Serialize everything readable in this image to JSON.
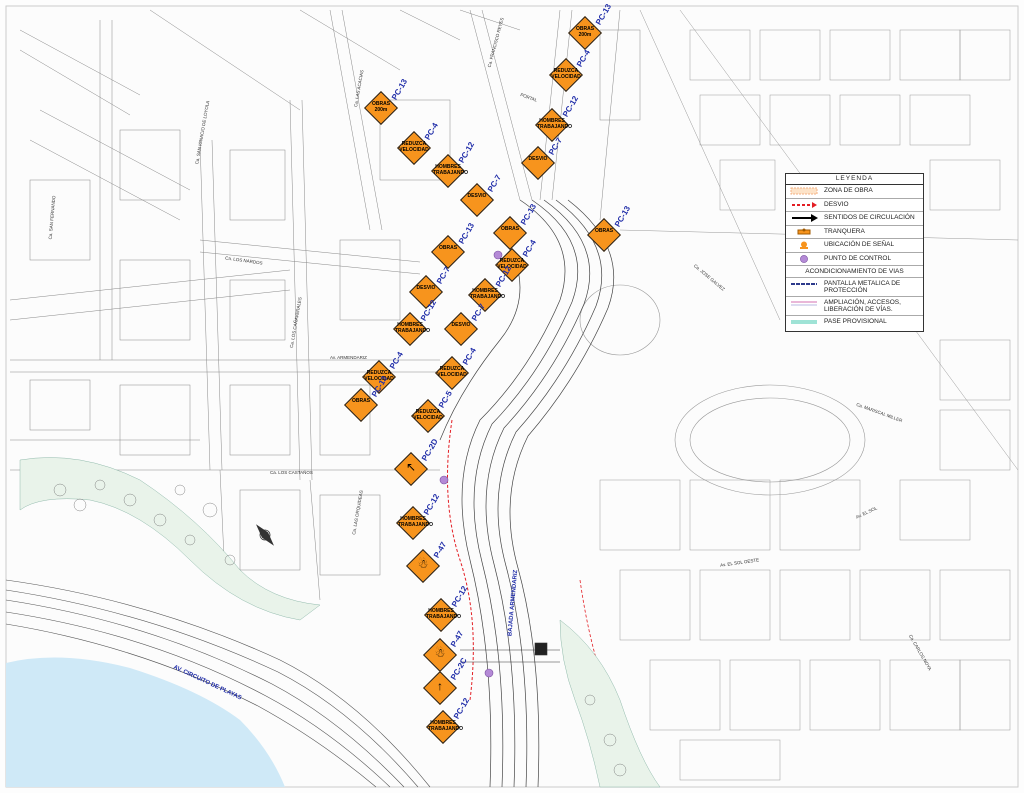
{
  "legend": {
    "title": "LEYENDA",
    "items": [
      {
        "label": "ZONA DE OBRA",
        "symbol": "zona-obra",
        "color": "#f4b183"
      },
      {
        "label": "DESVIO",
        "symbol": "desvio",
        "color": "#e31e24"
      },
      {
        "label": "SENTIDOS DE CIRCULACIÓN",
        "symbol": "sentido",
        "color": "#000000"
      },
      {
        "label": "TRANQUERA",
        "symbol": "tranquera",
        "color": "#f7941d"
      },
      {
        "label": "UBICACIÓN DE SEÑAL",
        "symbol": "senal",
        "color": "#f7941d"
      },
      {
        "label": "PUNTO DE CONTROL",
        "symbol": "control",
        "color": "#b48ad6"
      }
    ],
    "subtitle": "ACONDICIONAMIENTO DE VIAS",
    "items2": [
      {
        "label": "PANTALLA METALICA DE PROTECCIÓN",
        "symbol": "pantalla",
        "color": "#2d3a8c"
      },
      {
        "label": "AMPLIACIÓN, ACCESOS, LIBERACIÓN DE VÍAS.",
        "symbol": "ampliacion",
        "color": "#d36fb0"
      },
      {
        "label": "PASE PROVISIONAL",
        "symbol": "pase",
        "color": "#9fe3d6"
      }
    ]
  },
  "signs": [
    {
      "code": "PC-13",
      "text": "OBRAS 200m"
    },
    {
      "code": "PC-4",
      "text": "REDUZCA VELOCIDAD"
    },
    {
      "code": "PC-12",
      "text": "HOMBRES TRABAJANDO"
    },
    {
      "code": "PC-13",
      "text": "OBRAS 200m"
    },
    {
      "code": "PC-4",
      "text": "REDUZCA VELOCIDAD"
    },
    {
      "code": "PC-12",
      "text": "HOMBRES TRABAJANDO"
    },
    {
      "code": "PC-7",
      "text": "DESVIO"
    },
    {
      "code": "PC-7",
      "text": "DESVIO"
    },
    {
      "code": "PC-13",
      "text": "OBRAS"
    },
    {
      "code": "PC-13",
      "text": "OBRAS"
    },
    {
      "code": "PC-13",
      "text": "OBRAS"
    },
    {
      "code": "PC-4",
      "text": "REDUZCA VELOCIDAD"
    },
    {
      "code": "PC-7",
      "text": "DESVIO"
    },
    {
      "code": "PC-12",
      "text": "HOMBRES TRABAJANDO"
    },
    {
      "code": "PC-12",
      "text": "HOMBRES TRABAJANDO"
    },
    {
      "code": "PC-7",
      "text": "DESVIO"
    },
    {
      "code": "PC-4",
      "text": "REDUZCA VELOCIDAD"
    },
    {
      "code": "PC-4",
      "text": "REDUZCA VELOCIDAD"
    },
    {
      "code": "PC-13",
      "text": "OBRAS"
    },
    {
      "code": "PC-5",
      "text": "REDUZCA VELOCIDAD"
    },
    {
      "code": "PC-2D",
      "text": ""
    },
    {
      "code": "PC-12",
      "text": "HOMBRES TRABAJANDO"
    },
    {
      "code": "P-47",
      "text": ""
    },
    {
      "code": "PC-12",
      "text": "HOMBRES TRABAJANDO"
    },
    {
      "code": "P-47",
      "text": ""
    },
    {
      "code": "PC-2C",
      "text": ""
    },
    {
      "code": "PC-12",
      "text": "HOMBRES TRABAJANDO"
    }
  ],
  "streets": [
    "Ca. LAS ACACIAS",
    "Ca. FRANCISCO REYES",
    "PORTAL",
    "Ca. SAN IGNACIO DE LOYOLA",
    "Ca. SAN FERNANDO",
    "Ca. LOS NARDOS",
    "Ca. LOS CAÑAVERALES",
    "Av. ARMENDARIZ",
    "Ca. LOS CASTAÑOS",
    "Ca. LAS ORQUIDEAS",
    "Av. EL SOL",
    "Av. EL SOL OESTE",
    "Ca. JOSE GALVEZ",
    "Ca. MARISCAL MILLER",
    "Ca. CARLOS NOYA"
  ],
  "major_roads": {
    "circuito": "AV. CIRCUITO DE PLAYAS",
    "bajada": "BAJADA ARMENDARIZ"
  },
  "icons": [
    "north-arrow-icon",
    "warning-sign-icon",
    "control-point-icon"
  ]
}
